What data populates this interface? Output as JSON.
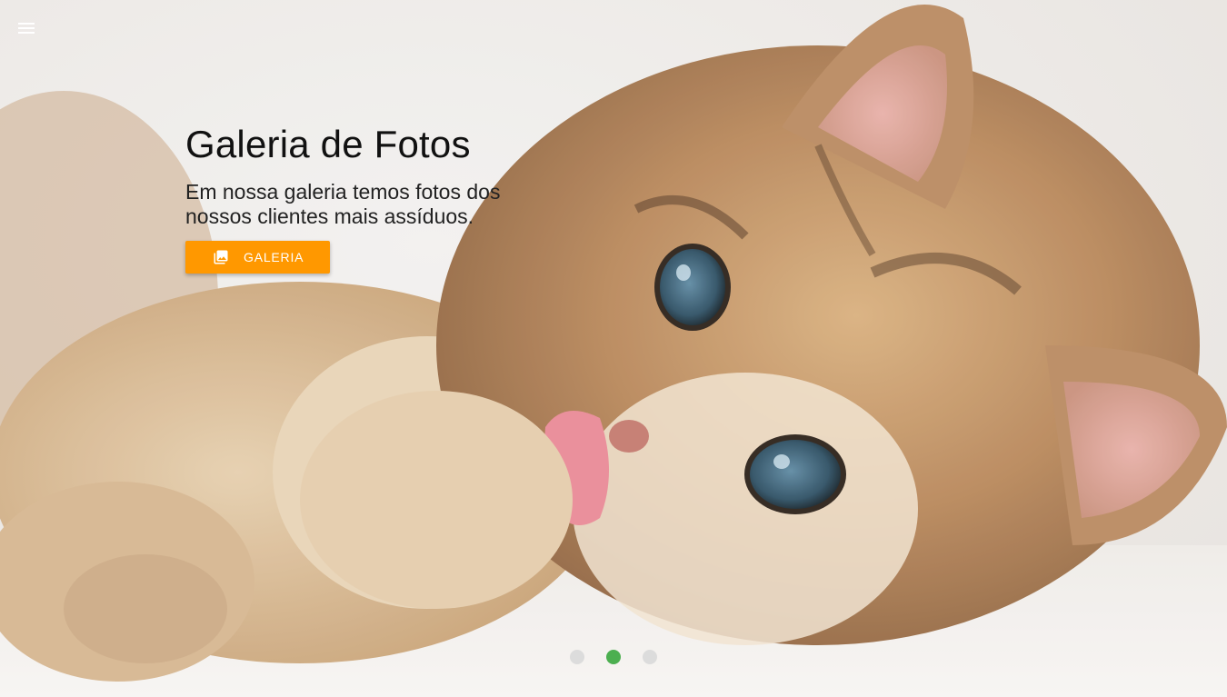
{
  "nav": {
    "menu_icon": "menu-icon"
  },
  "slider": {
    "slide_image": "kitten-photo",
    "title": "Galeria de Fotos",
    "description": "Em nossa galeria temos fotos dos nossos clientes mais assíduos.",
    "button": {
      "label": "GALERIA",
      "icon": "photo-library-icon",
      "color": "#ff9800"
    },
    "indicators": {
      "total": 3,
      "active_index": 1,
      "active_color": "#4caf50",
      "inactive_color": "#dcdcdc"
    }
  }
}
